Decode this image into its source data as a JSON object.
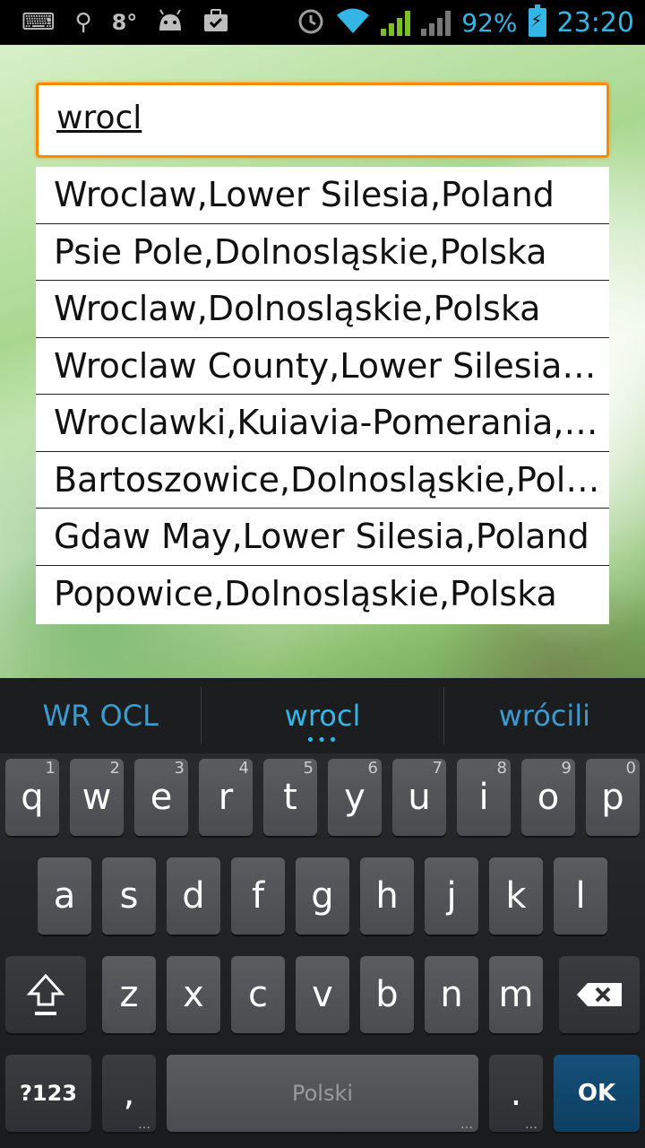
{
  "status_bar": {
    "temperature": "8°",
    "battery_percent": "92%",
    "time": "23:20",
    "icons": [
      "keyboard-icon",
      "usb-icon",
      "android-icon",
      "briefcase-icon",
      "alarm-icon",
      "wifi-icon",
      "signal-icon",
      "battery-icon"
    ]
  },
  "search": {
    "value": "wrocl"
  },
  "suggestions": [
    "Wroclaw,Lower Silesia,Poland",
    "Psie Pole,Dolnosląskie,Polska",
    "Wroclaw,Dolnosląskie,Polska",
    "Wroclaw County,Lower Silesia,Poland",
    "Wroclawki,Kuiavia-Pomerania,Poland",
    "Bartoszowice,Dolnosląskie,Polska",
    "Gdaw May,Lower Silesia,Poland",
    "Popowice,Dolnosląskie,Polska"
  ],
  "keyboard": {
    "candidates": [
      "WR OCL",
      "wrocl",
      "wrócili"
    ],
    "row1": [
      {
        "key": "q",
        "hint": "1"
      },
      {
        "key": "w",
        "hint": "2"
      },
      {
        "key": "e",
        "hint": "3"
      },
      {
        "key": "r",
        "hint": "4"
      },
      {
        "key": "t",
        "hint": "5"
      },
      {
        "key": "y",
        "hint": "6"
      },
      {
        "key": "u",
        "hint": "7"
      },
      {
        "key": "i",
        "hint": "8"
      },
      {
        "key": "o",
        "hint": "9"
      },
      {
        "key": "p",
        "hint": "0"
      }
    ],
    "row2": [
      "a",
      "s",
      "d",
      "f",
      "g",
      "h",
      "j",
      "k",
      "l"
    ],
    "row3": [
      "z",
      "x",
      "c",
      "v",
      "b",
      "n",
      "m"
    ],
    "symbols_label": "?123",
    "comma_label": ",",
    "space_label": "Polski",
    "period_label": ".",
    "ok_label": "OK"
  }
}
